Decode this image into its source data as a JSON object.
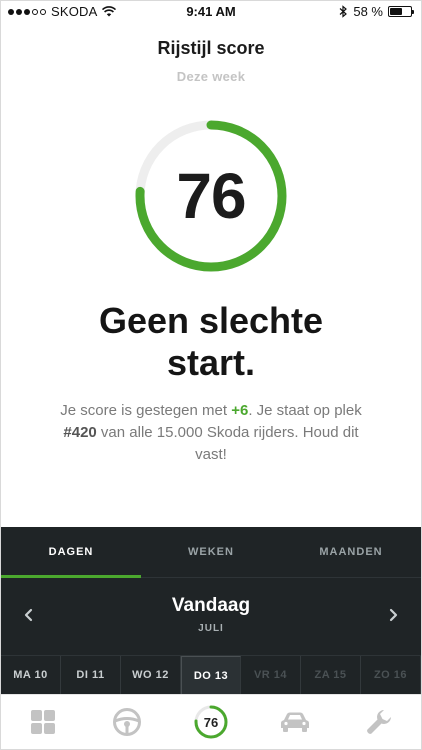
{
  "status_bar": {
    "carrier": "SKODA",
    "time": "9:41 AM",
    "battery": "58 %",
    "battery_level": 0.58,
    "signal_bars_filled": 3,
    "signal_bars_total": 5
  },
  "header": {
    "title": "Rijstijl score",
    "subtitle": "Deze week"
  },
  "score": {
    "value": "76",
    "fraction": 0.76,
    "ring_color": "#4ba82e",
    "track_color": "#eeeeee"
  },
  "headline": {
    "line1": "Geen slechte",
    "line2": "start."
  },
  "description": {
    "part1": "Je score is gestegen met ",
    "delta": "+6",
    "part2": ". Je staat op plek ",
    "rank": "#420",
    "part3": " van alle 15.000 Skoda rijders. Houd dit vast!"
  },
  "period_tabs": [
    {
      "label": "DAGEN",
      "active": true
    },
    {
      "label": "WEKEN",
      "active": false
    },
    {
      "label": "MAANDEN",
      "active": false
    }
  ],
  "date_nav": {
    "title": "Vandaag",
    "month": "JULI",
    "prev_icon": "chevron-left-icon",
    "next_icon": "chevron-right-icon"
  },
  "days": [
    {
      "label": "MA 10",
      "state": "past"
    },
    {
      "label": "DI 11",
      "state": "past"
    },
    {
      "label": "WO 12",
      "state": "past"
    },
    {
      "label": "DO 13",
      "state": "selected"
    },
    {
      "label": "VR 14",
      "state": "future"
    },
    {
      "label": "ZA 15",
      "state": "future"
    },
    {
      "label": "ZO 16",
      "state": "future"
    }
  ],
  "tab_bar": {
    "items": [
      {
        "icon": "dashboard-grid-icon"
      },
      {
        "icon": "steering-wheel-icon"
      },
      {
        "icon": "score-ring-icon",
        "value": "76"
      },
      {
        "icon": "car-icon"
      },
      {
        "icon": "wrench-icon"
      }
    ],
    "icon_color": "#c3c3c3",
    "accent": "#4ba82e"
  },
  "colors": {
    "accent": "#4ba82e",
    "panel": "#1f2426"
  }
}
